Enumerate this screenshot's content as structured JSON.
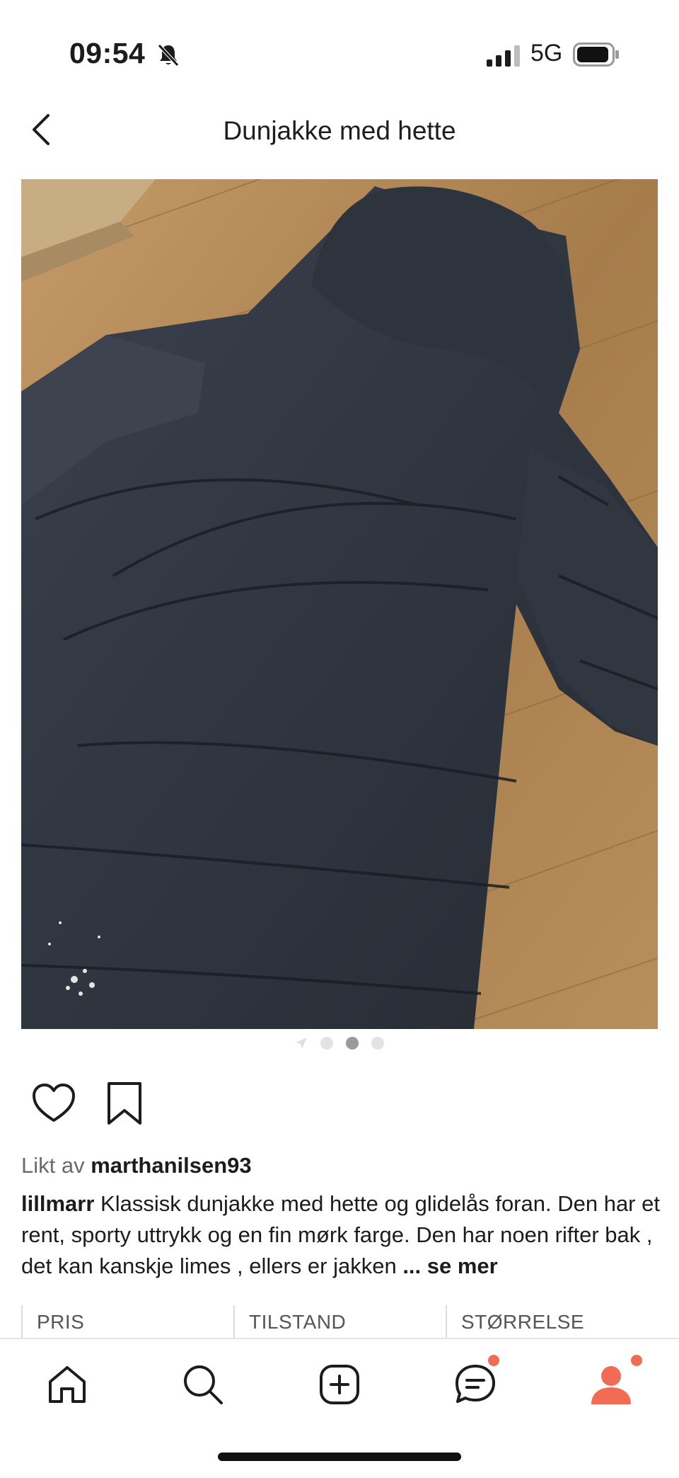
{
  "status_bar": {
    "time": "09:54",
    "network": "5G",
    "icons": [
      "bell-slash-icon",
      "signal-icon",
      "battery-icon"
    ]
  },
  "header": {
    "title": "Dunjakke med hette",
    "back_icon": "chevron-left-icon"
  },
  "listing": {
    "photo": "dark navy puffer jacket with hood on wooden floor",
    "carousel": {
      "total": 3,
      "active": 2
    },
    "liked_by_prefix": "Likt av",
    "liked_by_user": "marthanilsen93",
    "seller": "lillmarr",
    "description": "Klassisk dunjakke med hette og glidelås foran. Den har et rent, sporty uttrykk og en fin mørk farge. Den har noen rifter bak , det kan kanskje limes , ellers er jakken",
    "see_more": "... se mer",
    "info_headers": [
      "PRIS",
      "TILSTAND",
      "STØRRELSE"
    ]
  },
  "tab_bar": {
    "tabs": [
      "home-icon",
      "search-icon",
      "add-icon",
      "messages-icon",
      "profile-icon"
    ],
    "badge_color": "#f26b55",
    "active_color": "#f26b55"
  }
}
